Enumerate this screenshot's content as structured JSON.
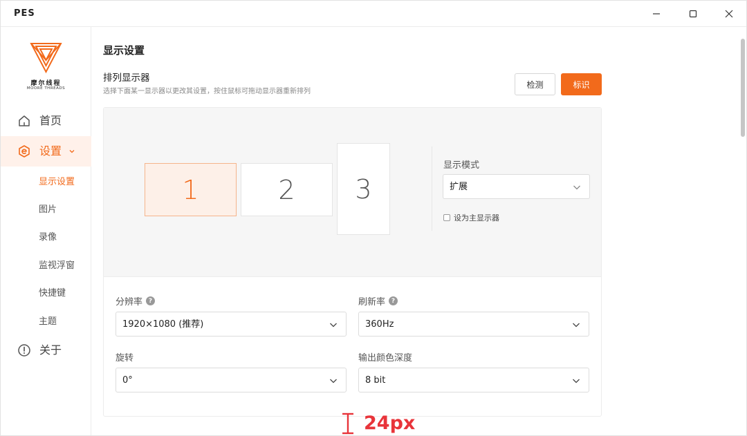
{
  "window": {
    "app_title": "PES",
    "controls": [
      "minimize-icon",
      "maximize-icon",
      "close-icon"
    ]
  },
  "sidebar": {
    "logo": {
      "cn": "摩尔线程",
      "en": "MOORE THREADS",
      "icon": "moore-threads-logo",
      "color": "#f26a1b"
    },
    "items": [
      {
        "label": "首页",
        "icon": "home-icon"
      },
      {
        "label": "设置",
        "icon": "settings-icon",
        "active": true,
        "expanded": true
      },
      {
        "label": "关于",
        "icon": "info-icon"
      }
    ],
    "subitems": [
      {
        "label": "显示设置",
        "active": true
      },
      {
        "label": "图片"
      },
      {
        "label": "录像"
      },
      {
        "label": "监视浮窗"
      },
      {
        "label": "快捷键"
      },
      {
        "label": "主题"
      }
    ]
  },
  "main": {
    "title": "显示设置",
    "arrange": {
      "title": "排列显示器",
      "subtitle": "选择下面某一显示器以更改其设置，按住鼠标可拖动显示器重新排列",
      "detect_label": "检测",
      "identify_label": "标识",
      "monitors": [
        "1",
        "2",
        "3"
      ],
      "selected_monitor": "1"
    },
    "display_mode": {
      "label": "显示模式",
      "value": "扩展",
      "primary_label": "设为主显示器",
      "primary_checked": false
    },
    "fields": {
      "resolution": {
        "label": "分辨率",
        "value": "1920×1080 (推荐)"
      },
      "refresh_rate": {
        "label": "刷新率",
        "value": "360Hz"
      },
      "rotation": {
        "label": "旋转",
        "value": "0°"
      },
      "color_depth": {
        "label": "输出颜色深度",
        "value": "8 bit"
      }
    },
    "help_glyph": "?",
    "annotation": "24px"
  },
  "colors": {
    "accent": "#f26a1b",
    "accent_light": "#fff1ea",
    "annotation": "#e8343a"
  }
}
